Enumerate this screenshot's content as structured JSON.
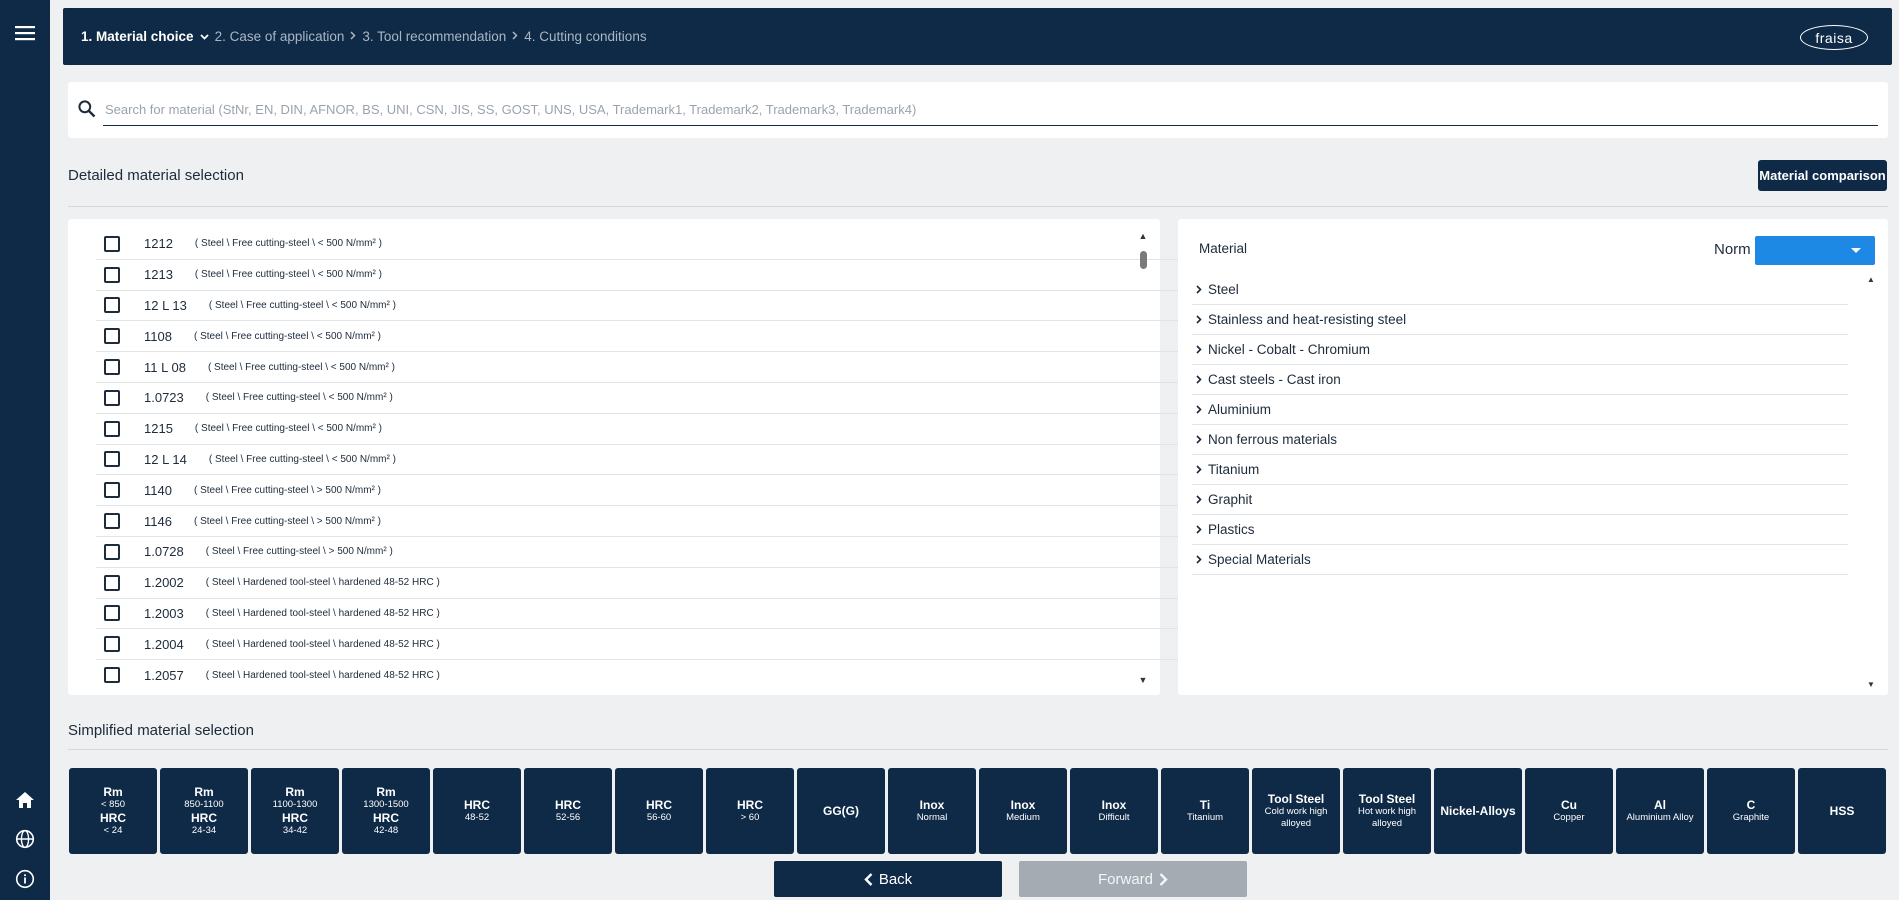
{
  "nav": {
    "crumbs": [
      {
        "label": "1. Material choice",
        "active": true
      },
      {
        "label": "2. Case of application",
        "active": false
      },
      {
        "label": "3. Tool recommendation",
        "active": false
      },
      {
        "label": "4. Cutting conditions",
        "active": false
      }
    ],
    "logo": "fraisa"
  },
  "icons": {
    "menu": "menu-icon",
    "home": "home-icon",
    "globe": "globe-icon",
    "info": "info-icon",
    "search": "search-icon"
  },
  "search": {
    "placeholder": "Search for material (StNr, EN, DIN, AFNOR, BS, UNI, CSN, JIS, SS, GOST, UNS, USA, Trademark1, Trademark2, Trademark3, Trademark4)",
    "value": ""
  },
  "detailed": {
    "title": "Detailed material selection",
    "compare_label": "Material comparison",
    "materials": [
      {
        "code": "1212",
        "desc": "( Steel \\ Free cutting-steel \\ < 500 N/mm² )"
      },
      {
        "code": "1213",
        "desc": "( Steel \\ Free cutting-steel \\ < 500 N/mm² )"
      },
      {
        "code": "12 L 13",
        "desc": "( Steel \\ Free cutting-steel \\ < 500 N/mm² )"
      },
      {
        "code": "1108",
        "desc": "( Steel \\ Free cutting-steel \\ < 500 N/mm² )"
      },
      {
        "code": "11 L 08",
        "desc": "( Steel \\ Free cutting-steel \\ < 500 N/mm² )"
      },
      {
        "code": "1.0723",
        "desc": "( Steel \\ Free cutting-steel \\ < 500 N/mm² )"
      },
      {
        "code": "1215",
        "desc": "( Steel \\ Free cutting-steel \\ < 500 N/mm² )"
      },
      {
        "code": "12 L 14",
        "desc": "( Steel \\ Free cutting-steel \\ < 500 N/mm² )"
      },
      {
        "code": "1140",
        "desc": "( Steel \\ Free cutting-steel \\ > 500 N/mm² )"
      },
      {
        "code": "1146",
        "desc": "( Steel \\ Free cutting-steel \\ > 500 N/mm² )"
      },
      {
        "code": "1.0728",
        "desc": "( Steel \\ Free cutting-steel \\ > 500 N/mm² )"
      },
      {
        "code": "1.2002",
        "desc": "( Steel \\ Hardened tool-steel \\ hardened 48-52 HRC )"
      },
      {
        "code": "1.2003",
        "desc": "( Steel \\ Hardened tool-steel \\ hardened 48-52 HRC )"
      },
      {
        "code": "1.2004",
        "desc": "( Steel \\ Hardened tool-steel \\ hardened 48-52 HRC )"
      },
      {
        "code": "1.2057",
        "desc": "( Steel \\ Hardened tool-steel \\ hardened 48-52 HRC )"
      }
    ]
  },
  "tree": {
    "header": "Material",
    "norm_label": "Norm",
    "norm_value": "",
    "items": [
      "Steel",
      "Stainless and heat-resisting steel",
      "Nickel - Cobalt - Chromium",
      "Cast steels - Cast iron",
      "Aluminium",
      "Non ferrous materials",
      "Titanium",
      "Graphit",
      "Plastics",
      "Special Materials"
    ]
  },
  "simplified": {
    "title": "Simplified material selection",
    "tiles": [
      {
        "lines": [
          {
            "t": "Rm",
            "b": true
          },
          {
            "t": "< 850",
            "b": false
          },
          {
            "t": "HRC",
            "b": true
          },
          {
            "t": "< 24",
            "b": false
          }
        ]
      },
      {
        "lines": [
          {
            "t": "Rm",
            "b": true
          },
          {
            "t": "850-1100",
            "b": false
          },
          {
            "t": "HRC",
            "b": true
          },
          {
            "t": "24-34",
            "b": false
          }
        ]
      },
      {
        "lines": [
          {
            "t": "Rm",
            "b": true
          },
          {
            "t": "1100-1300",
            "b": false
          },
          {
            "t": "HRC",
            "b": true
          },
          {
            "t": "34-42",
            "b": false
          }
        ]
      },
      {
        "lines": [
          {
            "t": "Rm",
            "b": true
          },
          {
            "t": "1300-1500",
            "b": false
          },
          {
            "t": "HRC",
            "b": true
          },
          {
            "t": "42-48",
            "b": false
          }
        ]
      },
      {
        "lines": [
          {
            "t": "HRC",
            "b": true
          },
          {
            "t": "48-52",
            "b": false
          }
        ]
      },
      {
        "lines": [
          {
            "t": "HRC",
            "b": true
          },
          {
            "t": "52-56",
            "b": false
          }
        ]
      },
      {
        "lines": [
          {
            "t": "HRC",
            "b": true
          },
          {
            "t": "56-60",
            "b": false
          }
        ]
      },
      {
        "lines": [
          {
            "t": "HRC",
            "b": true
          },
          {
            "t": "> 60",
            "b": false
          }
        ]
      },
      {
        "lines": [
          {
            "t": "GG(G)",
            "b": true
          }
        ]
      },
      {
        "lines": [
          {
            "t": "Inox",
            "b": true
          },
          {
            "t": "Normal",
            "b": false
          }
        ]
      },
      {
        "lines": [
          {
            "t": "Inox",
            "b": true
          },
          {
            "t": "Medium",
            "b": false
          }
        ]
      },
      {
        "lines": [
          {
            "t": "Inox",
            "b": true
          },
          {
            "t": "Difficult",
            "b": false
          }
        ]
      },
      {
        "lines": [
          {
            "t": "Ti",
            "b": true
          },
          {
            "t": "Titanium",
            "b": false
          }
        ]
      },
      {
        "lines": [
          {
            "t": "Tool Steel",
            "b": true
          },
          {
            "t": "Cold work high",
            "b": false
          },
          {
            "t": "alloyed",
            "b": false
          }
        ]
      },
      {
        "lines": [
          {
            "t": "Tool Steel",
            "b": true
          },
          {
            "t": "Hot work high",
            "b": false
          },
          {
            "t": "alloyed",
            "b": false
          }
        ]
      },
      {
        "lines": [
          {
            "t": "Nickel-Alloys",
            "b": true
          }
        ]
      },
      {
        "lines": [
          {
            "t": "Cu",
            "b": true
          },
          {
            "t": "Copper",
            "b": false
          }
        ]
      },
      {
        "lines": [
          {
            "t": "Al",
            "b": true
          },
          {
            "t": "Aluminium Alloy",
            "b": false
          }
        ]
      },
      {
        "lines": [
          {
            "t": "C",
            "b": true
          },
          {
            "t": "Graphite",
            "b": false
          }
        ]
      },
      {
        "lines": [
          {
            "t": "HSS",
            "b": true
          }
        ]
      }
    ]
  },
  "footer": {
    "back_label": "Back",
    "forward_label": "Forward"
  },
  "colors": {
    "primary": "#0e2a47",
    "accent": "#1e88e5",
    "disabled": "#a4abb3",
    "background": "#eef0f2"
  }
}
